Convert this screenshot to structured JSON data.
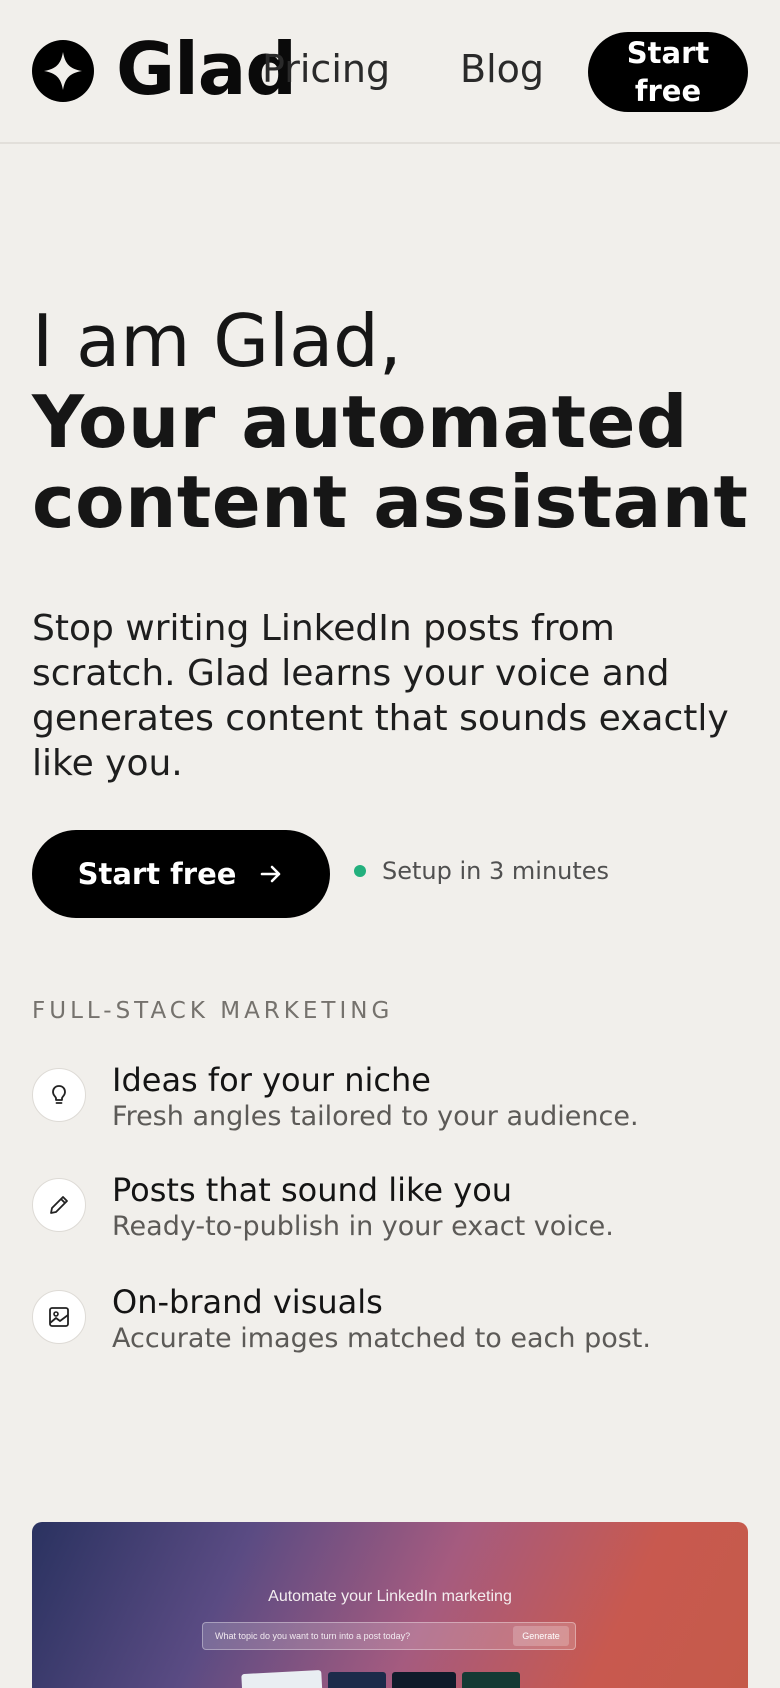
{
  "header": {
    "brand": "Glad",
    "nav": [
      "Pricing",
      "Blog"
    ],
    "cta": "Start free"
  },
  "hero": {
    "title_line1": "I am Glad,",
    "title_line2": "Your automated content assistant",
    "subtitle": "Stop writing LinkedIn posts from scratch. Glad learns your voice and generates content that sounds exactly like you.",
    "cta": "Start free",
    "setup_note": "Setup in 3 minutes",
    "status_color": "#23b07d"
  },
  "features": {
    "eyebrow": "FULL-STACK MARKETING",
    "items": [
      {
        "icon": "lightbulb-icon",
        "title": "Ideas for your niche",
        "desc": "Fresh angles tailored to your audience."
      },
      {
        "icon": "pencil-icon",
        "title": "Posts that sound like you",
        "desc": "Ready-to-publish in your exact voice."
      },
      {
        "icon": "image-icon",
        "title": "On-brand visuals",
        "desc": "Accurate images matched to each post."
      }
    ]
  },
  "preview": {
    "title": "Automate your LinkedIn marketing",
    "input_placeholder": "What topic do you want to turn into a post today?",
    "generate": "Generate"
  }
}
